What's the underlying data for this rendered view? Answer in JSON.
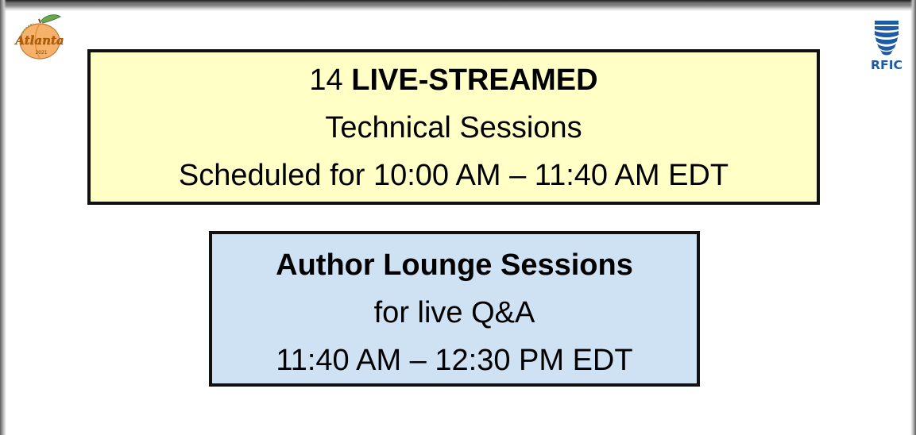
{
  "live_box": {
    "count": "14",
    "emphasis": "LIVE-STREAMED",
    "line2": "Technical Sessions",
    "line3": "Scheduled for 10:00 AM – 11:40 AM EDT",
    "background_color": "#ffffc6"
  },
  "author_box": {
    "title": "Author Lounge Sessions",
    "line2": "for live Q&A",
    "line3": "11:40 AM – 12:30 PM EDT",
    "background_color": "#cfe2f4"
  },
  "logos": {
    "left": {
      "icon": "atlanta-peach-logo",
      "text": "Atlanta",
      "year": "2021"
    },
    "right": {
      "icon": "rfic-logo",
      "text": "RFIC",
      "color": "#1f5aa6"
    }
  }
}
